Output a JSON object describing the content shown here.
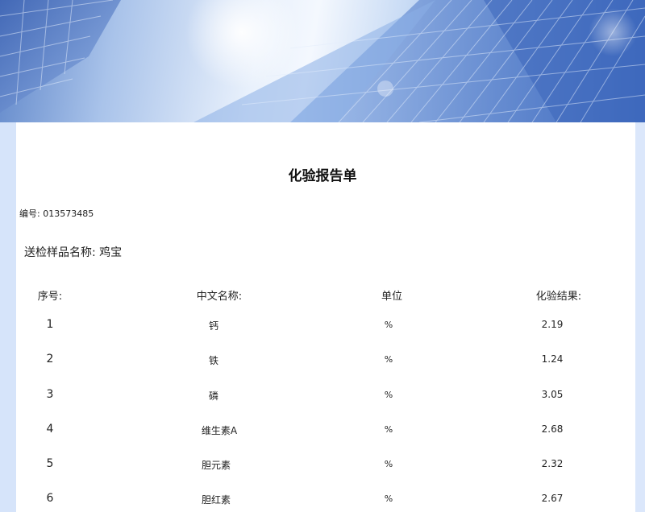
{
  "report": {
    "title": "化验报告单",
    "serial_label": "编号:",
    "serial_number": "013573485",
    "sample_label": "送检样品名称:",
    "sample_name": "鸡宝"
  },
  "table": {
    "headers": [
      "序号:",
      "中文名称:",
      "单位",
      "化验结果:"
    ],
    "rows": [
      {
        "index": "1",
        "name": "钙",
        "unit": "%",
        "result": "2.19"
      },
      {
        "index": "2",
        "name": "铁",
        "unit": "%",
        "result": "1.24"
      },
      {
        "index": "3",
        "name": "磷",
        "unit": "%",
        "result": "3.05"
      },
      {
        "index": "4",
        "name": "维生素A",
        "unit": "%",
        "result": "2.68"
      },
      {
        "index": "5",
        "name": "胆元素",
        "unit": "%",
        "result": "2.32"
      },
      {
        "index": "6",
        "name": "胆红素",
        "unit": "%",
        "result": "2.67"
      }
    ]
  },
  "banner": {
    "image": "glass-skyscraper-banner"
  }
}
